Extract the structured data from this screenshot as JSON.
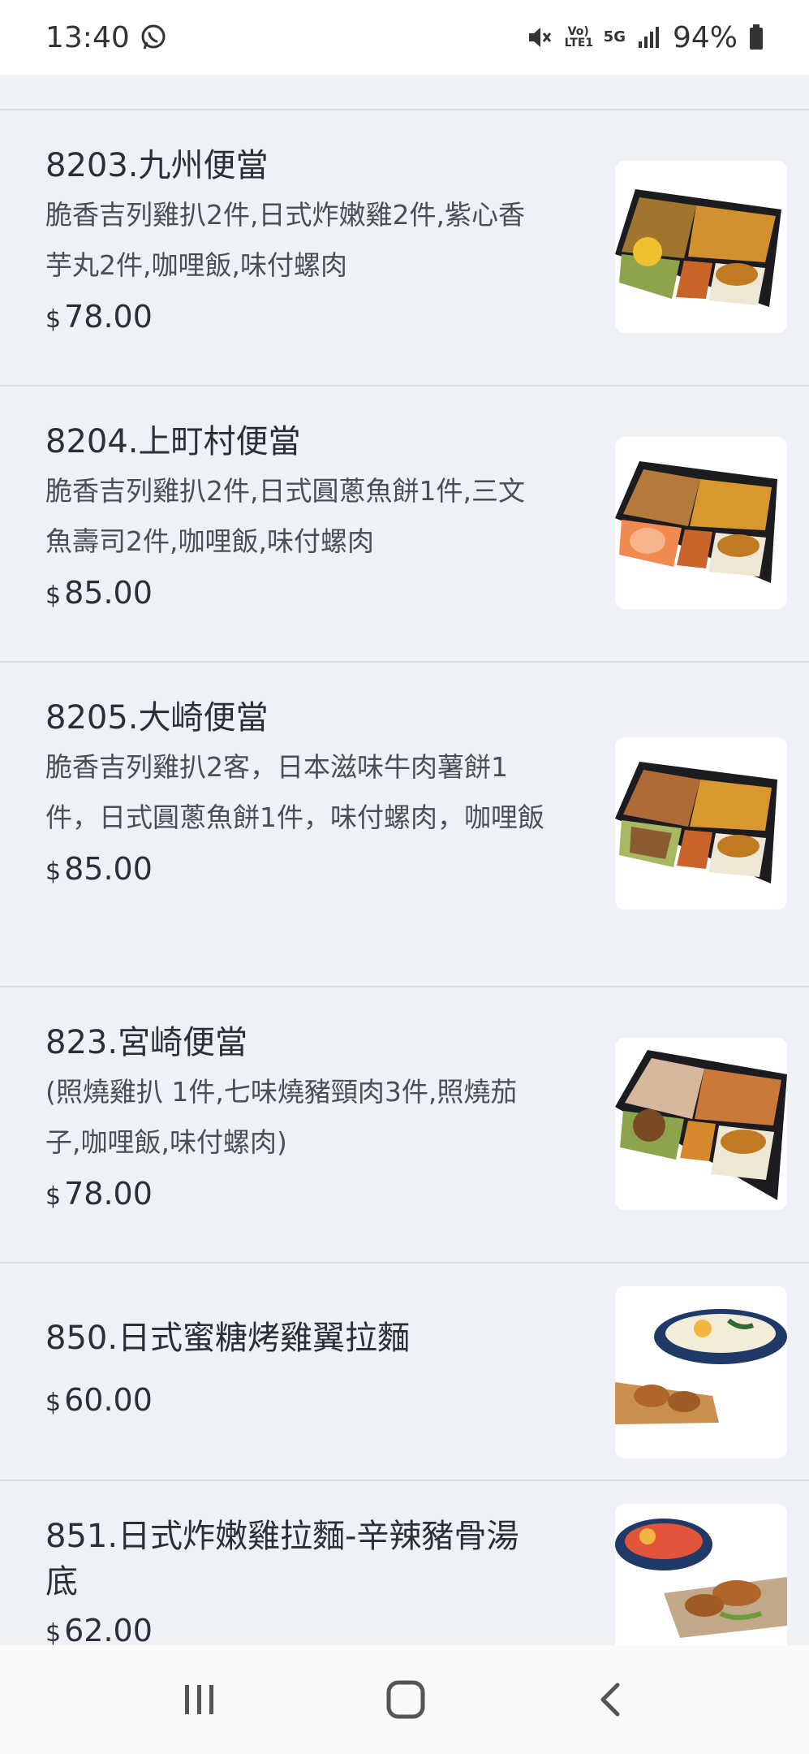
{
  "status": {
    "time": "13:40",
    "volte": "Vo) LTE1",
    "net": "5G",
    "battery": "94%"
  },
  "items": [
    {
      "title": "8203.九州便當",
      "desc": "脆香吉列雞扒2件,日式炸嫩雞2件,紫心香芋丸2件,咖哩飯,味付螺肉",
      "currency": "$",
      "price": "78.00"
    },
    {
      "title": "8204.上町村便當",
      "desc": "脆香吉列雞扒2件,日式圓蔥魚餅1件,三文魚壽司2件,咖哩飯,味付螺肉",
      "currency": "$",
      "price": "85.00"
    },
    {
      "title": "8205.大崎便當",
      "desc": "脆香吉列雞扒2客，日本滋味牛肉薯餅1件，日式圓蔥魚餅1件，味付螺肉，咖哩飯",
      "currency": "$",
      "price": "85.00"
    },
    {
      "title": "823.宮崎便當",
      "desc": "(照燒雞扒 1件,七味燒豬頸肉3件,照燒茄子,咖哩飯,味付螺肉)",
      "currency": "$",
      "price": "78.00"
    },
    {
      "title": "850.日式蜜糖烤雞翼拉麵",
      "desc": "",
      "currency": "$",
      "price": "60.00"
    },
    {
      "title": "851.日式炸嫩雞拉麵-辛辣豬骨湯底",
      "desc": "",
      "currency": "$",
      "price": "62.00"
    }
  ],
  "icons": {
    "whatsapp": "whatsapp-icon",
    "mute": "mute-icon",
    "signal": "signal-icon",
    "battery": "battery-icon",
    "recents": "recents-icon",
    "home": "home-icon",
    "back": "back-icon"
  }
}
